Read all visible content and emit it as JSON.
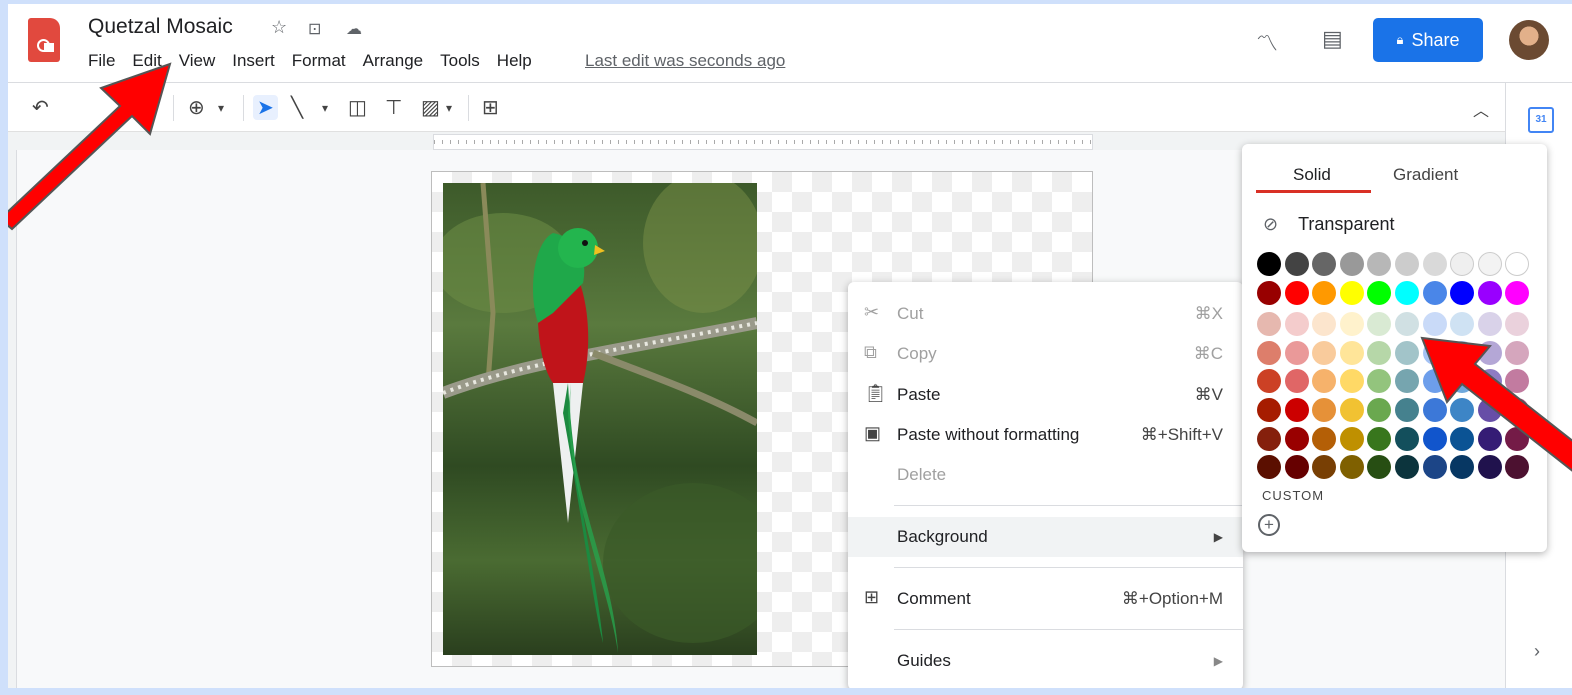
{
  "document": {
    "title": "Quetzal Mosaic",
    "menu": [
      "File",
      "Edit",
      "View",
      "Insert",
      "Format",
      "Arrange",
      "Tools",
      "Help"
    ],
    "last_edit": "Last edit was seconds ago"
  },
  "header": {
    "share_label": "Share"
  },
  "context_menu": {
    "cut": {
      "label": "Cut",
      "shortcut": "⌘X"
    },
    "copy": {
      "label": "Copy",
      "shortcut": "⌘C"
    },
    "paste": {
      "label": "Paste",
      "shortcut": "⌘V"
    },
    "paste_plain": {
      "label": "Paste without formatting",
      "shortcut": "⌘+Shift+V"
    },
    "delete": {
      "label": "Delete"
    },
    "background": {
      "label": "Background"
    },
    "comment": {
      "label": "Comment",
      "shortcut": "⌘+Option+M"
    },
    "guides": {
      "label": "Guides"
    }
  },
  "palette": {
    "tabs": [
      "Solid",
      "Gradient"
    ],
    "transparent_label": "Transparent",
    "custom_label": "CUSTOM",
    "rows": [
      [
        "#000000",
        "#434343",
        "#666666",
        "#999999",
        "#b7b7b7",
        "#cccccc",
        "#d9d9d9",
        "#efefef",
        "#f3f3f3",
        "#ffffff"
      ],
      [
        "#980000",
        "#ff0000",
        "#ff9900",
        "#ffff00",
        "#00ff00",
        "#00ffff",
        "#4a86e8",
        "#0000ff",
        "#9900ff",
        "#ff00ff"
      ],
      [
        "#e6b8af",
        "#f4cccc",
        "#fce5cd",
        "#fff2cc",
        "#d9ead3",
        "#d0e0e3",
        "#c9daf8",
        "#cfe2f3",
        "#d9d2e9",
        "#ead1dc"
      ],
      [
        "#dd7e6b",
        "#ea9999",
        "#f9cb9c",
        "#ffe599",
        "#b6d7a8",
        "#a2c4c9",
        "#a4c2f4",
        "#9fc5e8",
        "#b4a7d6",
        "#d5a6bd"
      ],
      [
        "#cc4125",
        "#e06666",
        "#f6b26b",
        "#ffd966",
        "#93c47d",
        "#76a5af",
        "#6d9eeb",
        "#6fa8dc",
        "#8e7cc3",
        "#c27ba0"
      ],
      [
        "#a61c00",
        "#cc0000",
        "#e69138",
        "#f1c232",
        "#6aa84f",
        "#45818e",
        "#3c78d8",
        "#3d85c6",
        "#674ea7",
        "#a64d79"
      ],
      [
        "#85200c",
        "#990000",
        "#b45f06",
        "#bf9000",
        "#38761d",
        "#134f5c",
        "#1155cc",
        "#0b5394",
        "#351c75",
        "#741b47"
      ],
      [
        "#5b0f00",
        "#660000",
        "#783f04",
        "#7f6000",
        "#274e13",
        "#0c343d",
        "#1c4587",
        "#073763",
        "#20124d",
        "#4c1130"
      ]
    ]
  },
  "colors": {
    "accent": "#1a73e8",
    "annotation_arrow": "#ff0000"
  }
}
